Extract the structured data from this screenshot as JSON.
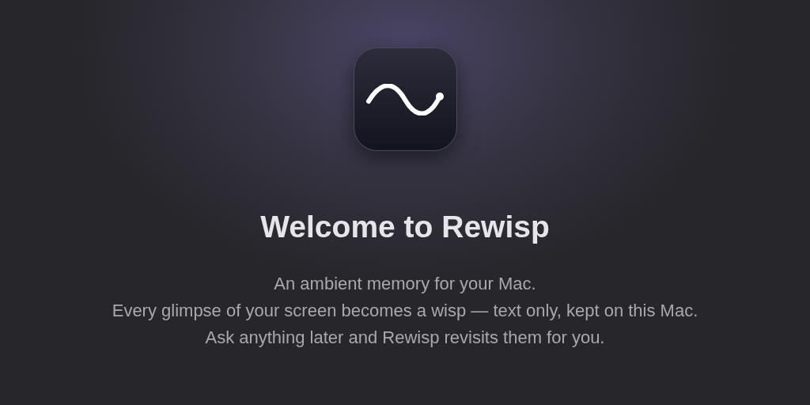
{
  "title": "Welcome to Rewisp",
  "description": [
    "An ambient memory for your Mac.",
    "Every glimpse of your screen becomes a wisp — text only, kept on this Mac.",
    "Ask anything later and Rewisp revisits them for you."
  ]
}
